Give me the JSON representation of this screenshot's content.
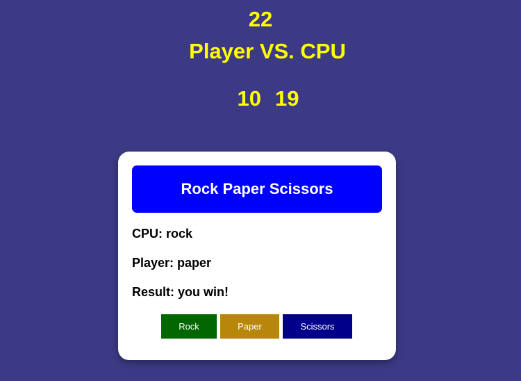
{
  "header": {
    "round": "22",
    "matchup": "Player VS. CPU",
    "player_score": "10",
    "cpu_score": "19"
  },
  "card": {
    "title": "Rock Paper Scissors",
    "cpu_line": "CPU: rock",
    "player_line": "Player: paper",
    "result_line": "Result: you win!",
    "buttons": {
      "rock": "Rock",
      "paper": "Paper",
      "scissors": "Scissors"
    }
  },
  "colors": {
    "background": "#3c3a85",
    "header_text": "#ffff00",
    "title_bar": "#0000ff",
    "rock_button": "#006600",
    "paper_button": "#b8860b",
    "scissors_button": "#00008b"
  }
}
